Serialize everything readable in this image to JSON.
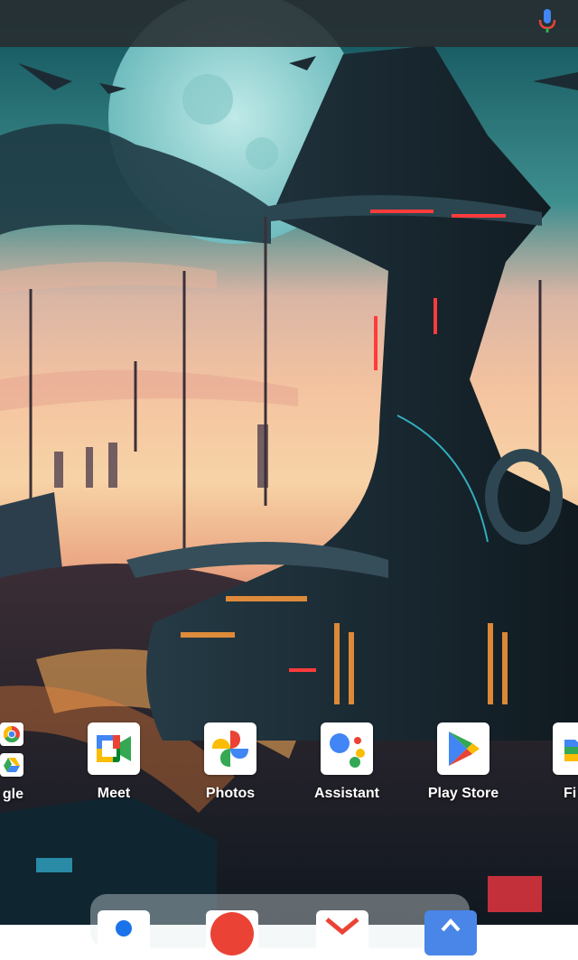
{
  "search_bar": {
    "icon": "mic-icon"
  },
  "folder": {
    "label": "gle",
    "apps": [
      "chrome-icon",
      "drive-icon"
    ]
  },
  "apps": [
    {
      "label": "Meet",
      "icon": "meet-icon"
    },
    {
      "label": "Photos",
      "icon": "photos-icon"
    },
    {
      "label": "Assistant",
      "icon": "assistant-icon"
    },
    {
      "label": "Play Store",
      "icon": "play-store-icon"
    },
    {
      "label": "Fi",
      "icon": "files-icon"
    }
  ],
  "dock": {
    "icons": [
      "contacts-icon",
      "youtube-icon",
      "gmail-icon",
      "maps-icon"
    ]
  },
  "colors": {
    "google_blue": "#4285F4",
    "google_red": "#EA4335",
    "google_yellow": "#FBBC04",
    "google_green": "#34A853"
  }
}
